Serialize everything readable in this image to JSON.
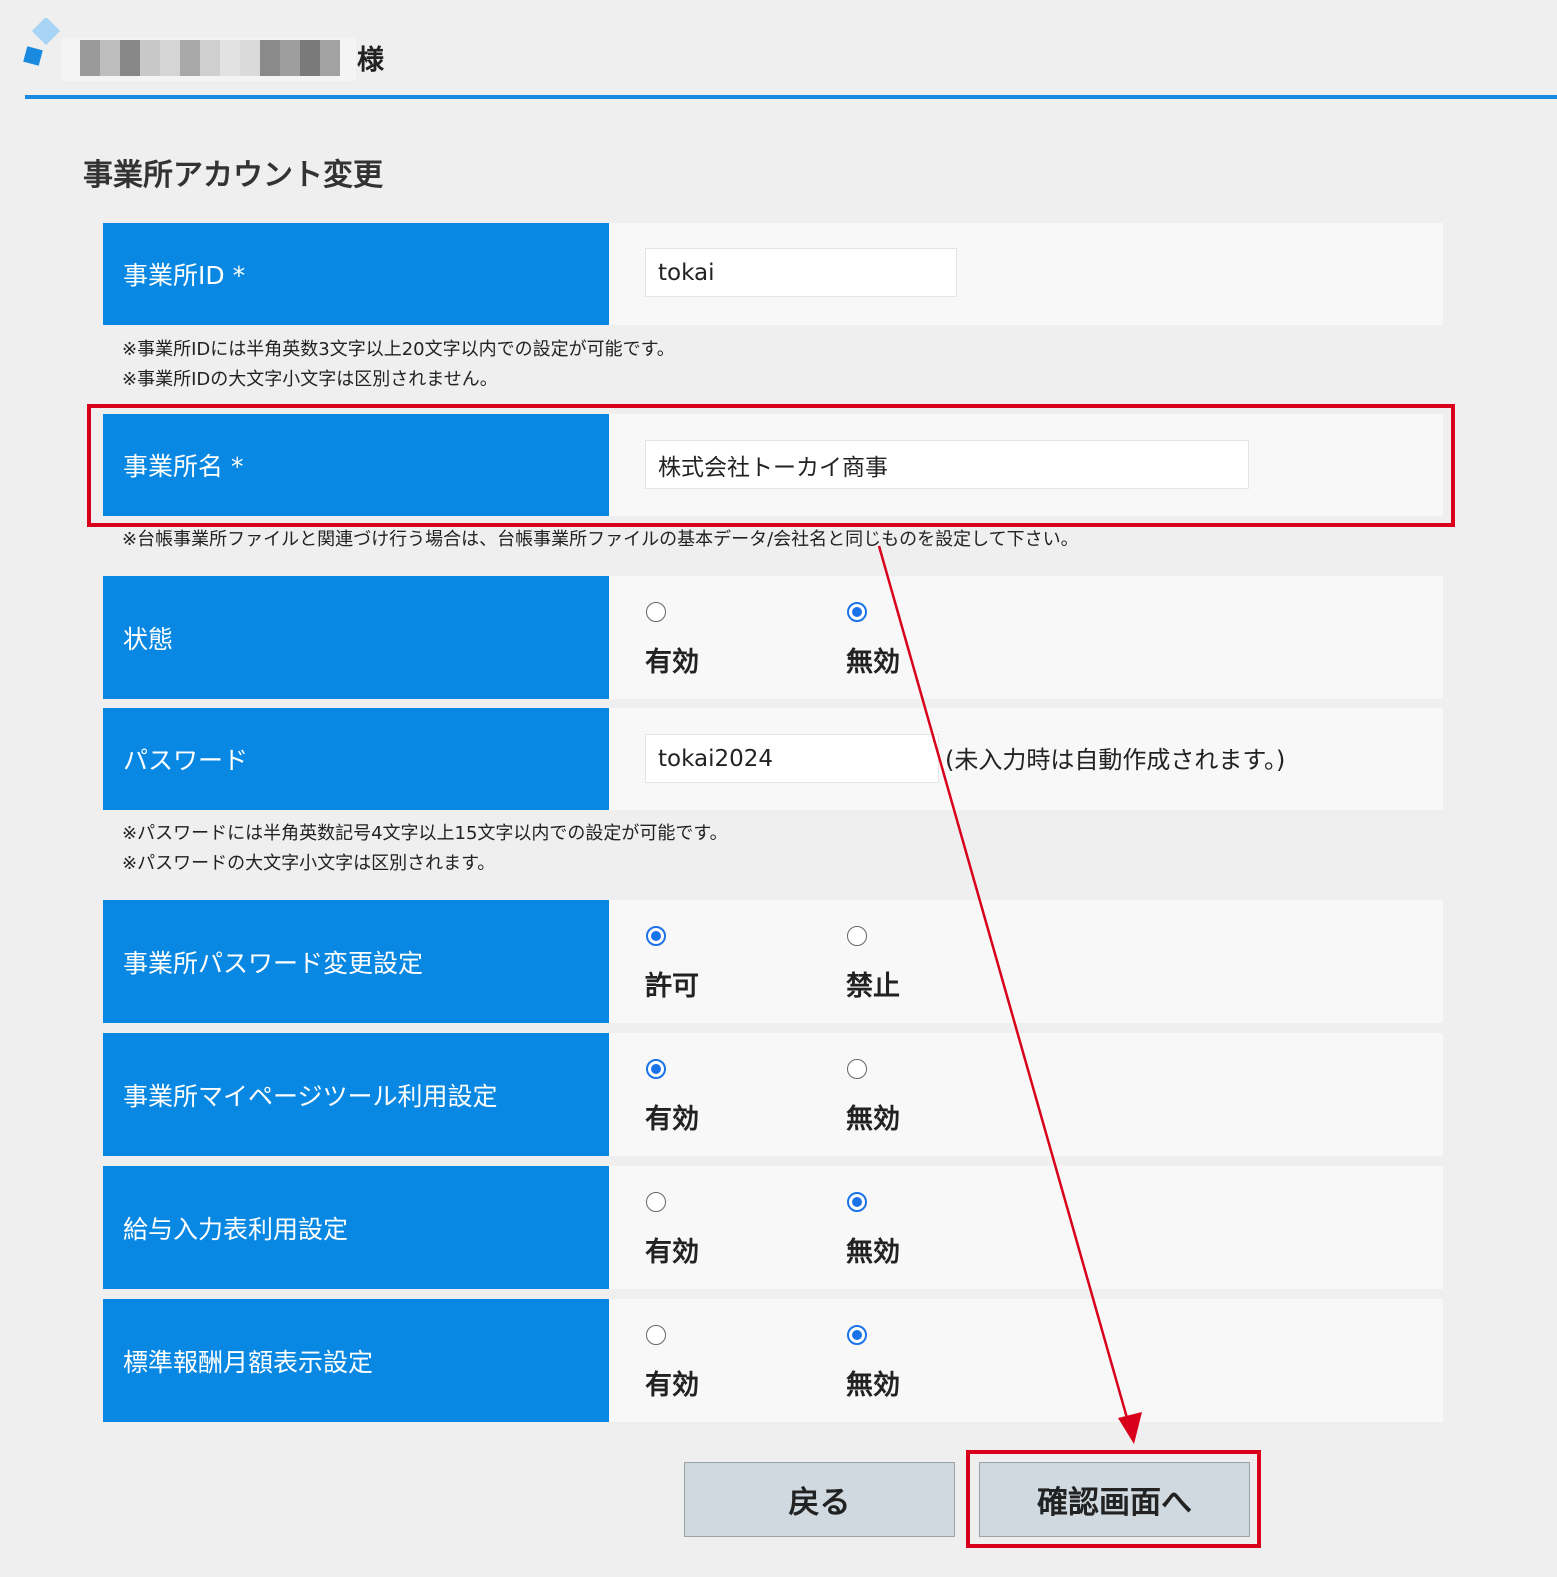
{
  "header": {
    "user_suffix": "様"
  },
  "page_title": "事業所アカウント変更",
  "form": {
    "office_id": {
      "label": "事業所ID *",
      "value": "tokai",
      "notes": [
        "※事業所IDには半角英数3文字以上20文字以内での設定が可能です。",
        "※事業所IDの大文字小文字は区別されません。"
      ]
    },
    "office_name": {
      "label": "事業所名 *",
      "value": "株式会社トーカイ商事",
      "note": "※台帳事業所ファイルと関連づけ行う場合は、台帳事業所ファイルの基本データ/会社名と同じものを設定して下さい。"
    },
    "status": {
      "label": "状態",
      "options": [
        "有効",
        "無効"
      ],
      "selected": "無効"
    },
    "password": {
      "label": "パスワード",
      "value": "tokai2024",
      "hint": "(未入力時は自動作成されます。)",
      "notes": [
        "※パスワードには半角英数記号4文字以上15文字以内での設定が可能です。",
        "※パスワードの大文字小文字は区別されます。"
      ]
    },
    "pw_change": {
      "label": "事業所パスワード変更設定",
      "options": [
        "許可",
        "禁止"
      ],
      "selected": "許可"
    },
    "mypage_tool": {
      "label": "事業所マイページツール利用設定",
      "options": [
        "有効",
        "無効"
      ],
      "selected": "有効"
    },
    "salary_input": {
      "label": "給与入力表利用設定",
      "options": [
        "有効",
        "無効"
      ],
      "selected": "無効"
    },
    "standard_pay": {
      "label": "標準報酬月額表示設定",
      "options": [
        "有効",
        "無効"
      ],
      "selected": "無効"
    }
  },
  "buttons": {
    "back": "戻る",
    "confirm": "確認画面へ"
  },
  "colors": {
    "label_bg": "#0888e2",
    "accent_line": "#1a8ae0",
    "highlight": "#d8001a",
    "radio_on": "#1a73e8"
  }
}
